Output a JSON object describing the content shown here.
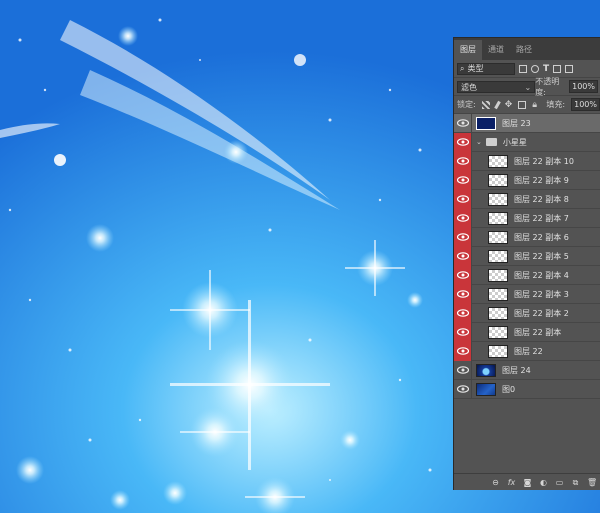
{
  "panel": {
    "tabs": [
      {
        "label": "图层",
        "active": true
      },
      {
        "label": "通道",
        "active": false
      },
      {
        "label": "路径",
        "active": false
      }
    ],
    "filter": {
      "label": "类型"
    },
    "blend_mode": "滤色",
    "opacity_label": "不透明度:",
    "opacity_value": "100%",
    "lock_label": "锁定:",
    "fill_label": "填充:",
    "fill_value": "100%"
  },
  "layers": [
    {
      "name": "图层 23",
      "kind": "image",
      "eye": "normal",
      "selected": true
    },
    {
      "name": "小星星",
      "kind": "group",
      "eye": "red"
    },
    {
      "name": "图层 22 副本 10",
      "kind": "sub",
      "eye": "red"
    },
    {
      "name": "图层 22 副本 9",
      "kind": "sub",
      "eye": "red"
    },
    {
      "name": "图层 22 副本 8",
      "kind": "sub",
      "eye": "red"
    },
    {
      "name": "图层 22 副本 7",
      "kind": "sub",
      "eye": "red"
    },
    {
      "name": "图层 22 副本 6",
      "kind": "sub",
      "eye": "red"
    },
    {
      "name": "图层 22 副本 5",
      "kind": "sub",
      "eye": "red"
    },
    {
      "name": "图层 22 副本 4",
      "kind": "sub",
      "eye": "red"
    },
    {
      "name": "图层 22 副本 3",
      "kind": "sub",
      "eye": "red"
    },
    {
      "name": "图层 22 副本 2",
      "kind": "sub",
      "eye": "red"
    },
    {
      "name": "图层 22 副本",
      "kind": "sub",
      "eye": "red"
    },
    {
      "name": "图层 22",
      "kind": "sub",
      "eye": "red"
    },
    {
      "name": "图层 24",
      "kind": "stars",
      "eye": "normal"
    },
    {
      "name": "图0",
      "kind": "image2",
      "eye": "normal"
    }
  ],
  "bottom_icons": [
    "link-icon",
    "fx-icon",
    "mask-icon",
    "adjustment-icon",
    "folder-icon",
    "new-layer-icon",
    "trash-icon"
  ],
  "colors": {
    "canvas_blue": "#2f95ea",
    "panel_bg": "#535353",
    "eye_red": "#c9353a"
  }
}
